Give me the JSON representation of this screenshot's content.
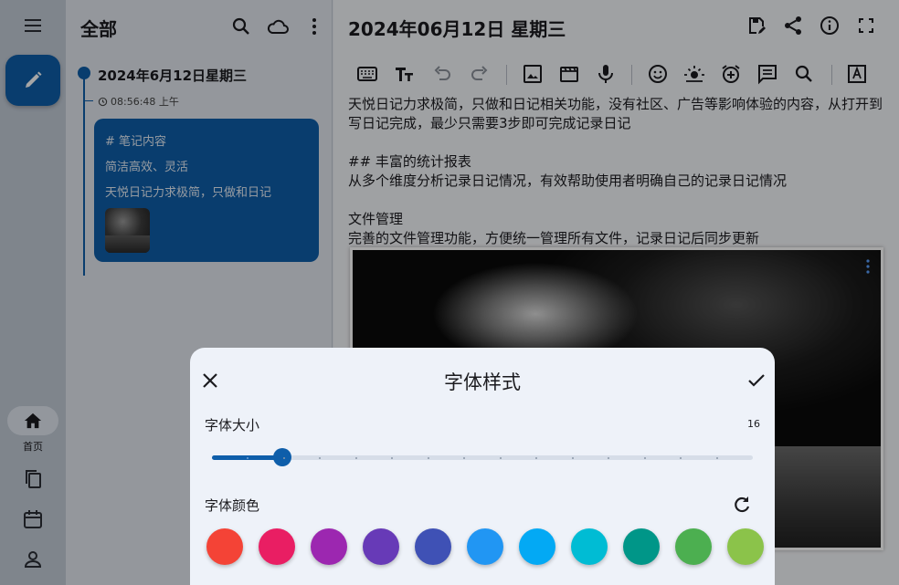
{
  "nav": {
    "menu_icon": "menu-icon",
    "compose_icon": "pencil-icon",
    "items": [
      {
        "label": "首页",
        "icon": "home-icon",
        "active": true
      },
      {
        "label": "",
        "icon": "copy-icon",
        "active": false
      },
      {
        "label": "",
        "icon": "calendar-icon",
        "active": false
      },
      {
        "label": "",
        "icon": "person-icon",
        "active": false
      }
    ]
  },
  "list": {
    "title": "全部",
    "actions": [
      "search-icon",
      "cloud-icon",
      "more-vert-icon"
    ],
    "entry": {
      "date": "2024年6月12日星期三",
      "time": "08:56:48 上午",
      "line1": "# 笔记内容",
      "line2": "简洁高效、灵活",
      "line3": "天悦日记力求极简，只做和日记"
    }
  },
  "editor": {
    "title": "2024年06月12日 星期三",
    "actions": [
      "save-edit-icon",
      "share-icon",
      "info-icon",
      "fullscreen-icon"
    ],
    "toolbar": [
      "keyboard-icon",
      "text-format-icon",
      "undo-icon",
      "redo-icon",
      "image-icon",
      "video-icon",
      "mic-icon",
      "emoji-icon",
      "weather-icon",
      "alarm-add-icon",
      "comment-icon",
      "search-icon",
      "text-style-icon"
    ],
    "paragraphs": [
      "天悦日记力求极简，只做和日记相关功能，没有社区、广告等影响体验的内容，从打开到写日记完成，最少只需要3步即可完成记录日记",
      "",
      "## 丰富的统计报表",
      "从多个维度分析记录日记情况，有效帮助使用者明确自己的记录日记情况",
      "",
      "文件管理",
      "完善的文件管理功能，方便统一管理所有文件，记录日记后同步更新"
    ]
  },
  "sheet": {
    "title": "字体样式",
    "size_label": "字体大小",
    "size_value": "16",
    "slider_fraction": 0.13,
    "slider_steps": 15,
    "color_label": "字体颜色",
    "colors": [
      "#f44336",
      "#e91e63",
      "#9c27b0",
      "#673ab7",
      "#3f51b5",
      "#2196f3",
      "#03a9f4",
      "#00bcd4",
      "#009688",
      "#4caf50",
      "#8bc34a"
    ]
  },
  "accent": "#0e5eaa"
}
